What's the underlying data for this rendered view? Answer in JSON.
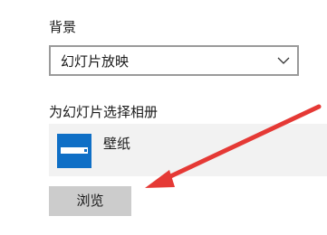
{
  "background": {
    "label": "背景",
    "dropdown": {
      "selected": "幻灯片放映",
      "icon": "chevron-down-icon"
    }
  },
  "slideshow": {
    "label": "为幻灯片选择相册",
    "album": {
      "name": "壁纸",
      "icon": "folder-icon",
      "icon_color": "#0f6fc6"
    },
    "browse_label": "浏览"
  },
  "annotation": {
    "arrow_color": "#e53935"
  }
}
